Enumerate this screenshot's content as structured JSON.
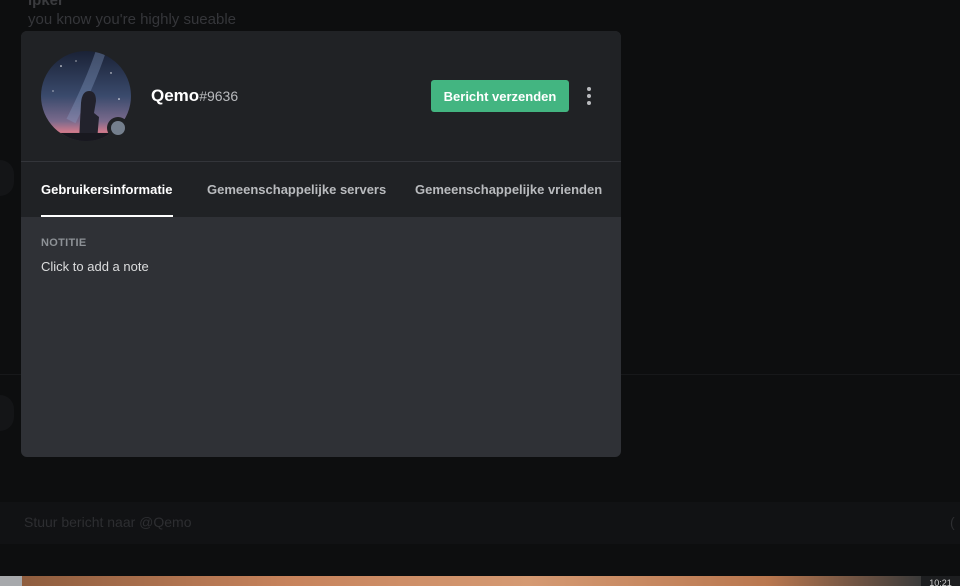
{
  "background": {
    "message_author": "ipker",
    "message_text": "you know you're highly sueable",
    "input_placeholder": "Stuur bericht naar @Qemo",
    "input_tail": "(",
    "clock": "10:21"
  },
  "profile": {
    "username": "Qemo",
    "discriminator": "#9636",
    "status": "offline",
    "send_message_label": "Bericht verzenden",
    "more_icon": "more-vertical-icon"
  },
  "tabs": [
    {
      "label": "Gebruikersinformatie",
      "active": true
    },
    {
      "label": "Gemeenschappelijke servers",
      "active": false
    },
    {
      "label": "Gemeenschappelijke vrienden",
      "active": false
    }
  ],
  "note": {
    "label": "NOTITIE",
    "placeholder": "Click to add a note"
  },
  "colors": {
    "accent_green": "#43b581",
    "header_bg": "#202225",
    "body_bg": "#2f3136",
    "status_offline": "#747f8d"
  }
}
